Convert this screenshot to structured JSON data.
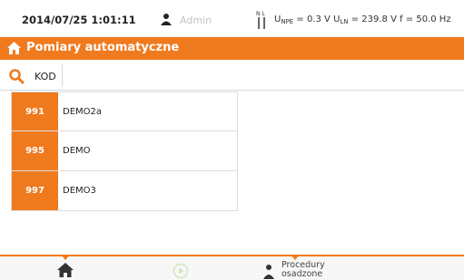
{
  "status": {
    "datetime": "2014/07/25 1:01:11",
    "user": "Admin",
    "probe_label": "N L",
    "u_npe_label": "U",
    "u_npe_sub": "NPE",
    "u_npe_value": " = 0.3 V ",
    "u_ln_label": "U",
    "u_ln_sub": "LN",
    "u_ln_value": " = 239.8 V ",
    "freq": "f = 50.0 Hz"
  },
  "header": {
    "title": "Pomiary automatyczne"
  },
  "search": {
    "label": "KOD",
    "value": "",
    "placeholder": ""
  },
  "procedures": [
    {
      "code": "991",
      "name": "DEMO2a"
    },
    {
      "code": "995",
      "name": "DEMO"
    },
    {
      "code": "997",
      "name": "DEMO3"
    }
  ],
  "bottom": {
    "procedures_label": "Procedury osadzone",
    "procedures_line1": "Procedury",
    "procedures_line2": "osadzone"
  },
  "colors": {
    "accent": "#f07a1e",
    "inactive": "#c4c4c4"
  }
}
